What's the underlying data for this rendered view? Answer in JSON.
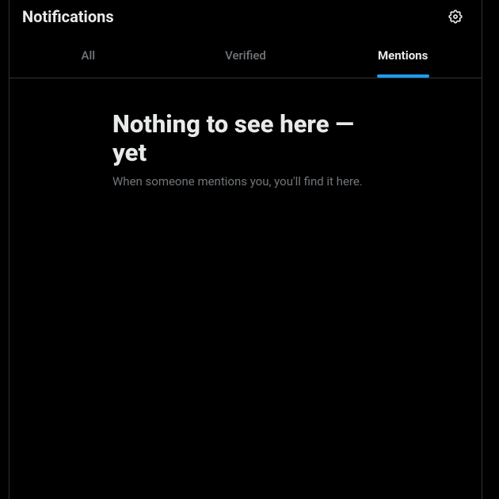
{
  "header": {
    "title": "Notifications"
  },
  "tabs": [
    {
      "label": "All",
      "active": false
    },
    {
      "label": "Verified",
      "active": false
    },
    {
      "label": "Mentions",
      "active": true
    }
  ],
  "emptyState": {
    "title": "Nothing to see here — yet",
    "subtitle": "When someone mentions you, you'll find it here."
  },
  "colors": {
    "accent": "#1d9bf0",
    "border": "#2f3336",
    "textPrimary": "#e7e9ea",
    "textSecondary": "#71767b"
  }
}
